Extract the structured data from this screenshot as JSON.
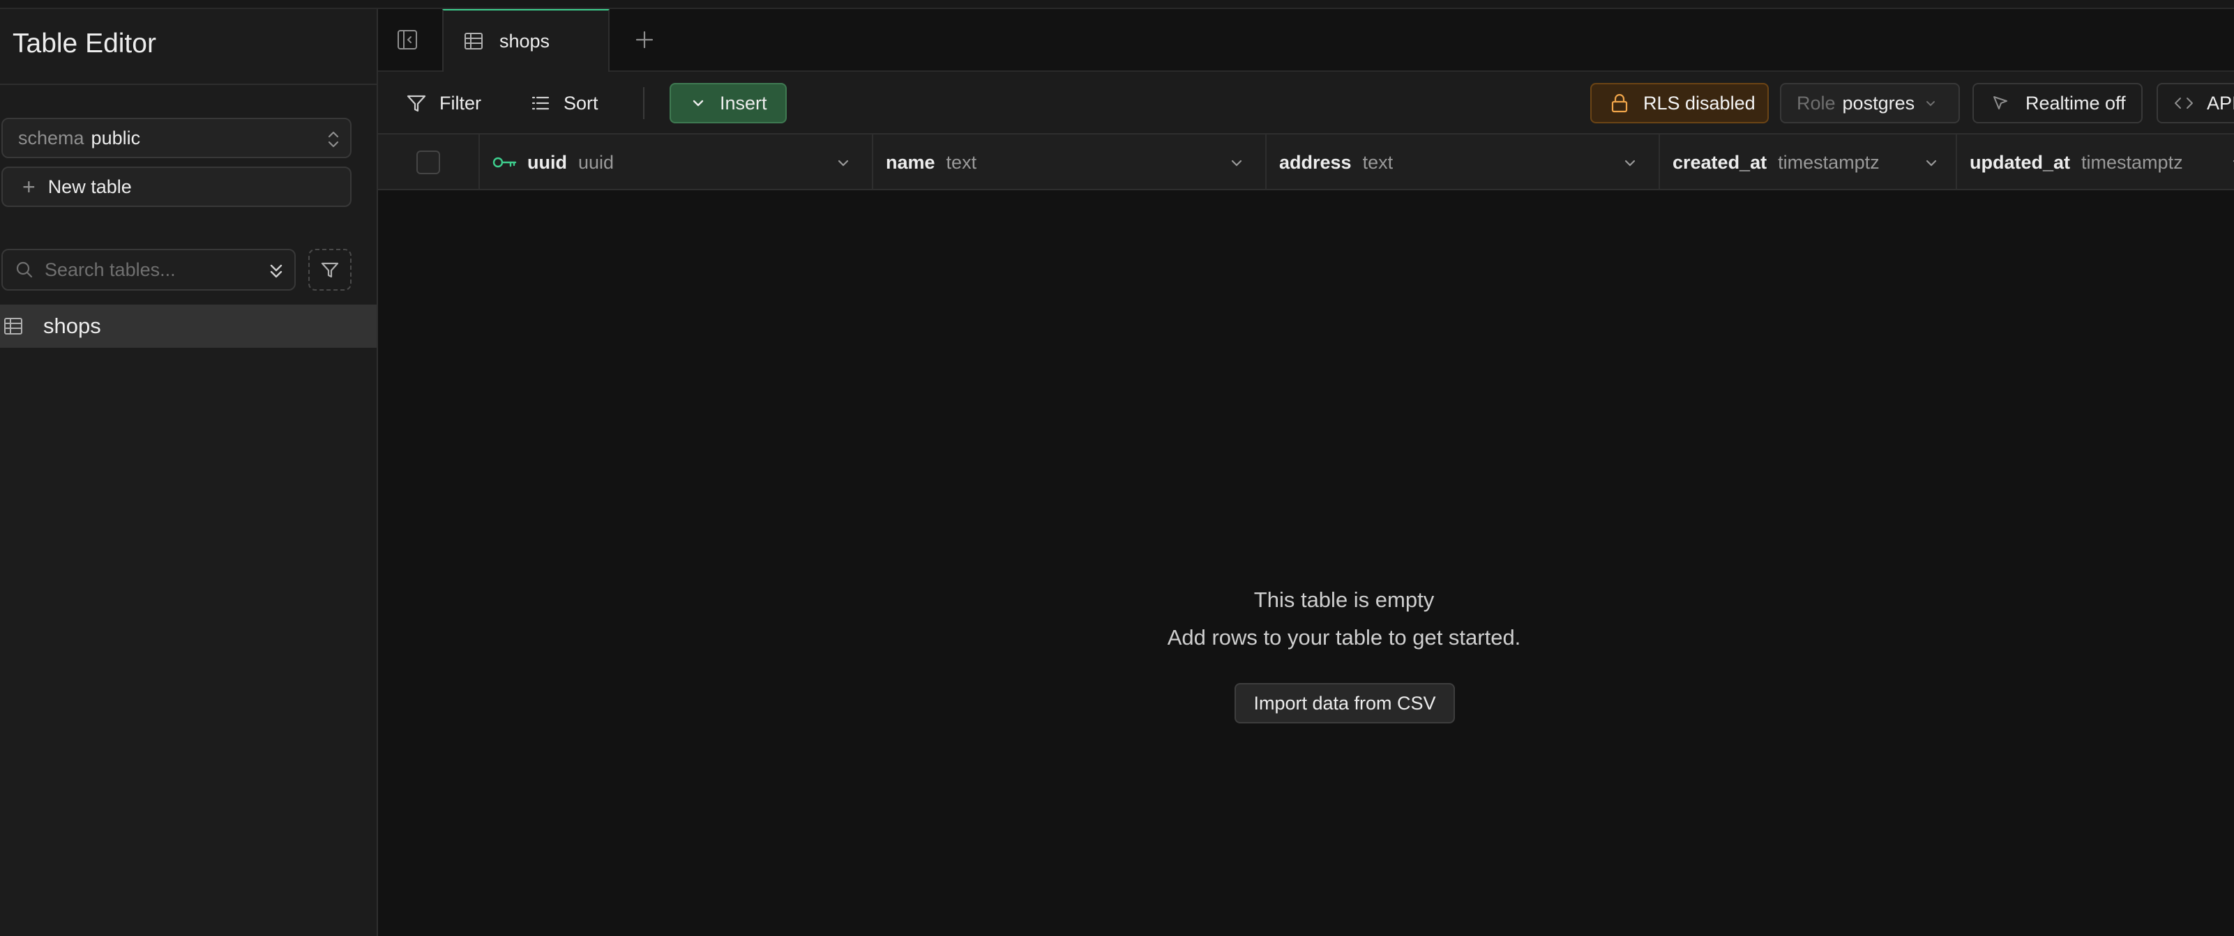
{
  "sidebar": {
    "title": "Table Editor",
    "schema": {
      "label": "schema",
      "value": "public"
    },
    "new_table_label": "New table",
    "search_placeholder": "Search tables...",
    "tables": [
      {
        "label": "shops"
      }
    ]
  },
  "tabs": {
    "active": {
      "label": "shops"
    }
  },
  "toolbar": {
    "filter_label": "Filter",
    "sort_label": "Sort",
    "insert_label": "Insert",
    "rls_label": "RLS disabled",
    "role_key": "Role",
    "role_value": "postgres",
    "realtime_label": "Realtime off",
    "api_label": "API"
  },
  "columns": [
    {
      "name": "uuid",
      "type": "uuid",
      "primary_key": true
    },
    {
      "name": "name",
      "type": "text"
    },
    {
      "name": "address",
      "type": "text"
    },
    {
      "name": "created_at",
      "type": "timestamptz"
    },
    {
      "name": "updated_at",
      "type": "timestamptz"
    }
  ],
  "empty_state": {
    "title": "This table is empty",
    "subtitle": "Add rows to your table to get started.",
    "import_label": "Import data from CSV"
  },
  "colors": {
    "accent_green": "#3ecf8e",
    "insert_bg": "#2b5a3a",
    "rls_bg": "#3a2610",
    "rls_icon": "#f0a54a",
    "key_icon": "#3ecf8e"
  },
  "icons": [
    "panel-toggle-icon",
    "table-icon",
    "plus-icon",
    "filter-icon",
    "sort-icon",
    "chevron-down-icon",
    "lock-icon",
    "cursor-icon",
    "code-icon",
    "search-icon",
    "double-chevron-icon",
    "key-icon",
    "selector-icon"
  ]
}
